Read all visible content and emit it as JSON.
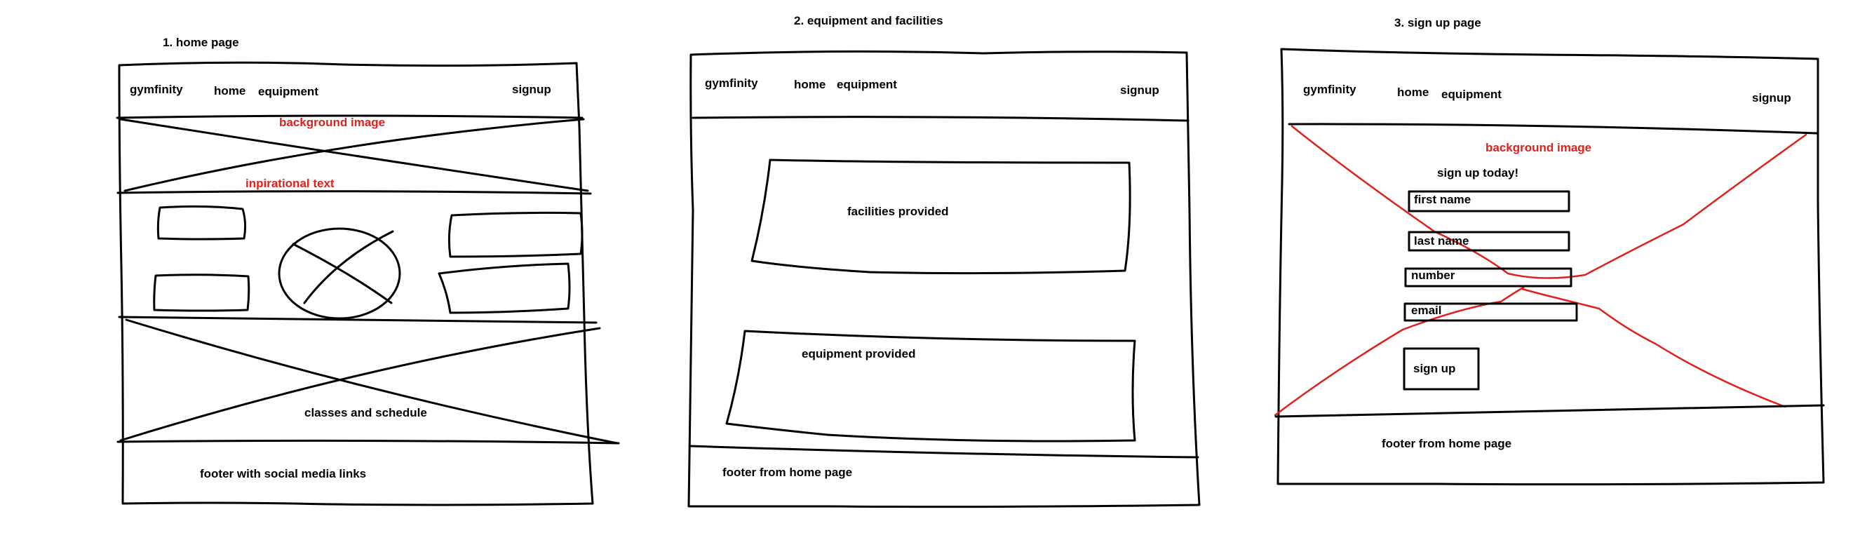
{
  "colors": {
    "ink": "#000000",
    "accent_red": "#e0201b",
    "background": "#ffffff"
  },
  "home": {
    "title": "1. home page",
    "nav": {
      "brand": "gymfinity",
      "home": "home",
      "equipment": "equipment",
      "signup": "signup"
    },
    "background_image_label": "background image",
    "inspirational_text": "inpirational text",
    "classes_label": "classes and schedule",
    "footer_label": "footer with social media links"
  },
  "equipment": {
    "title": "2. equipment and facilities",
    "nav": {
      "brand": "gymfinity",
      "home": "home",
      "equipment": "equipment",
      "signup": "signup"
    },
    "facilities_label": "facilities provided",
    "equipment_label": "equipment provided",
    "footer_label": "footer from home page"
  },
  "signup_page": {
    "title": "3. sign up page",
    "nav": {
      "brand": "gymfinity",
      "home": "home",
      "equipment": "equipment",
      "signup": "signup"
    },
    "background_image_label": "background image",
    "heading": "sign up today!",
    "fields": {
      "first_name": "first name",
      "last_name": "last name",
      "number": "number",
      "email": "email"
    },
    "button_label": "sign up",
    "footer_label": "footer from home page"
  }
}
